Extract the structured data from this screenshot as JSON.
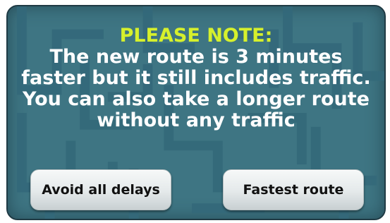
{
  "dialog": {
    "headline": "PLEASE NOTE:",
    "lines": [
      "The new route is 3 minutes",
      "faster but it still includes traffic.",
      "You can also take a longer route",
      "without any traffic"
    ]
  },
  "buttons": {
    "avoid_delays": "Avoid all delays",
    "fastest_route": "Fastest route"
  },
  "colors": {
    "background": "#3e7583",
    "headline": "#d6f02c",
    "text": "#ffffff",
    "button": "#e4e9ea"
  }
}
